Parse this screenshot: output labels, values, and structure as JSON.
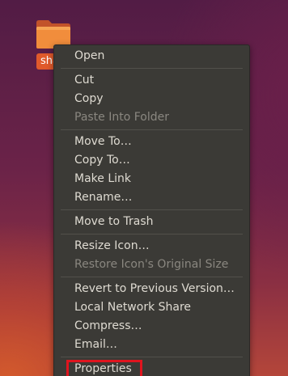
{
  "desktop": {
    "folder": {
      "label": "share",
      "icon": "folder-icon"
    }
  },
  "context_menu": {
    "groups": [
      [
        {
          "label": "Open",
          "enabled": true
        }
      ],
      [
        {
          "label": "Cut",
          "enabled": true
        },
        {
          "label": "Copy",
          "enabled": true
        },
        {
          "label": "Paste Into Folder",
          "enabled": false
        }
      ],
      [
        {
          "label": "Move To…",
          "enabled": true
        },
        {
          "label": "Copy To…",
          "enabled": true
        },
        {
          "label": "Make Link",
          "enabled": true
        },
        {
          "label": "Rename…",
          "enabled": true
        }
      ],
      [
        {
          "label": "Move to Trash",
          "enabled": true
        }
      ],
      [
        {
          "label": "Resize Icon…",
          "enabled": true
        },
        {
          "label": "Restore Icon's Original Size",
          "enabled": false
        }
      ],
      [
        {
          "label": "Revert to Previous Version…",
          "enabled": true
        },
        {
          "label": "Local Network Share",
          "enabled": true
        },
        {
          "label": "Compress…",
          "enabled": true
        },
        {
          "label": "Email…",
          "enabled": true
        }
      ],
      [
        {
          "label": "Properties",
          "enabled": true,
          "highlighted": true
        }
      ]
    ]
  },
  "colors": {
    "menu_background": "#3b3a36",
    "menu_text": "#dfdbd2",
    "menu_text_disabled": "#8a8780",
    "folder_accent": "#e05a2b",
    "highlight_border": "#e0141e"
  }
}
